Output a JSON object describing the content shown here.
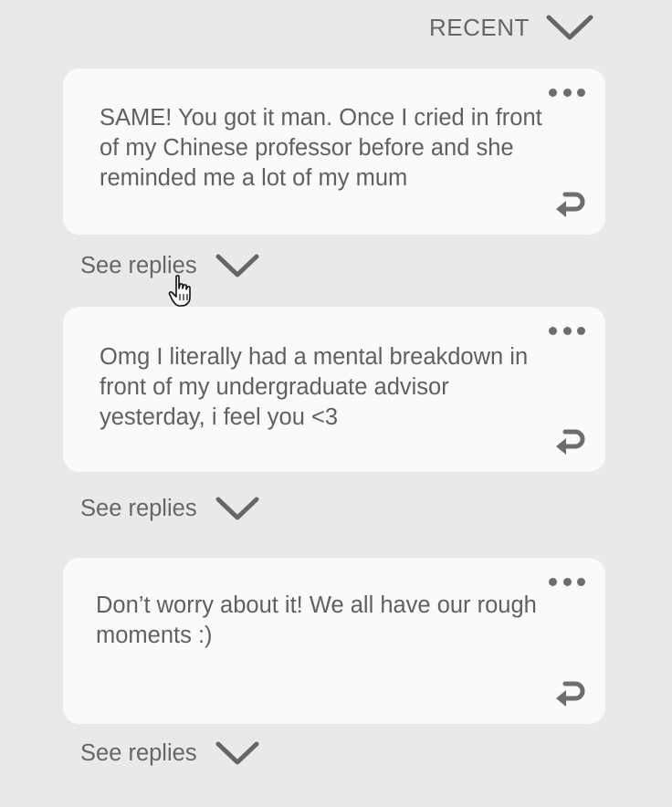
{
  "sort": {
    "label": "RECENT",
    "icon": "chevron-down-icon"
  },
  "comments": [
    {
      "text": "SAME! You got it man. Once I cried in front of my Chinese professor before and she reminded me a lot of my mum",
      "see_replies_label": "See replies",
      "more_icon": "more-options-icon",
      "reply_icon": "reply-icon"
    },
    {
      "text": "Omg I literally had a mental breakdown in front of my undergraduate advisor yesterday, i feel you <3",
      "see_replies_label": "See replies",
      "more_icon": "more-options-icon",
      "reply_icon": "reply-icon"
    },
    {
      "text": "Don’t worry about it! We all have our rough moments :)",
      "see_replies_label": "See replies",
      "more_icon": "more-options-icon",
      "reply_icon": "reply-icon"
    }
  ],
  "colors": {
    "background": "#e9e9e9",
    "card": "#fafafa",
    "text": "#606060",
    "icon": "#6d6d6d"
  },
  "pointer_icon": "hand-pointer-cursor-icon"
}
